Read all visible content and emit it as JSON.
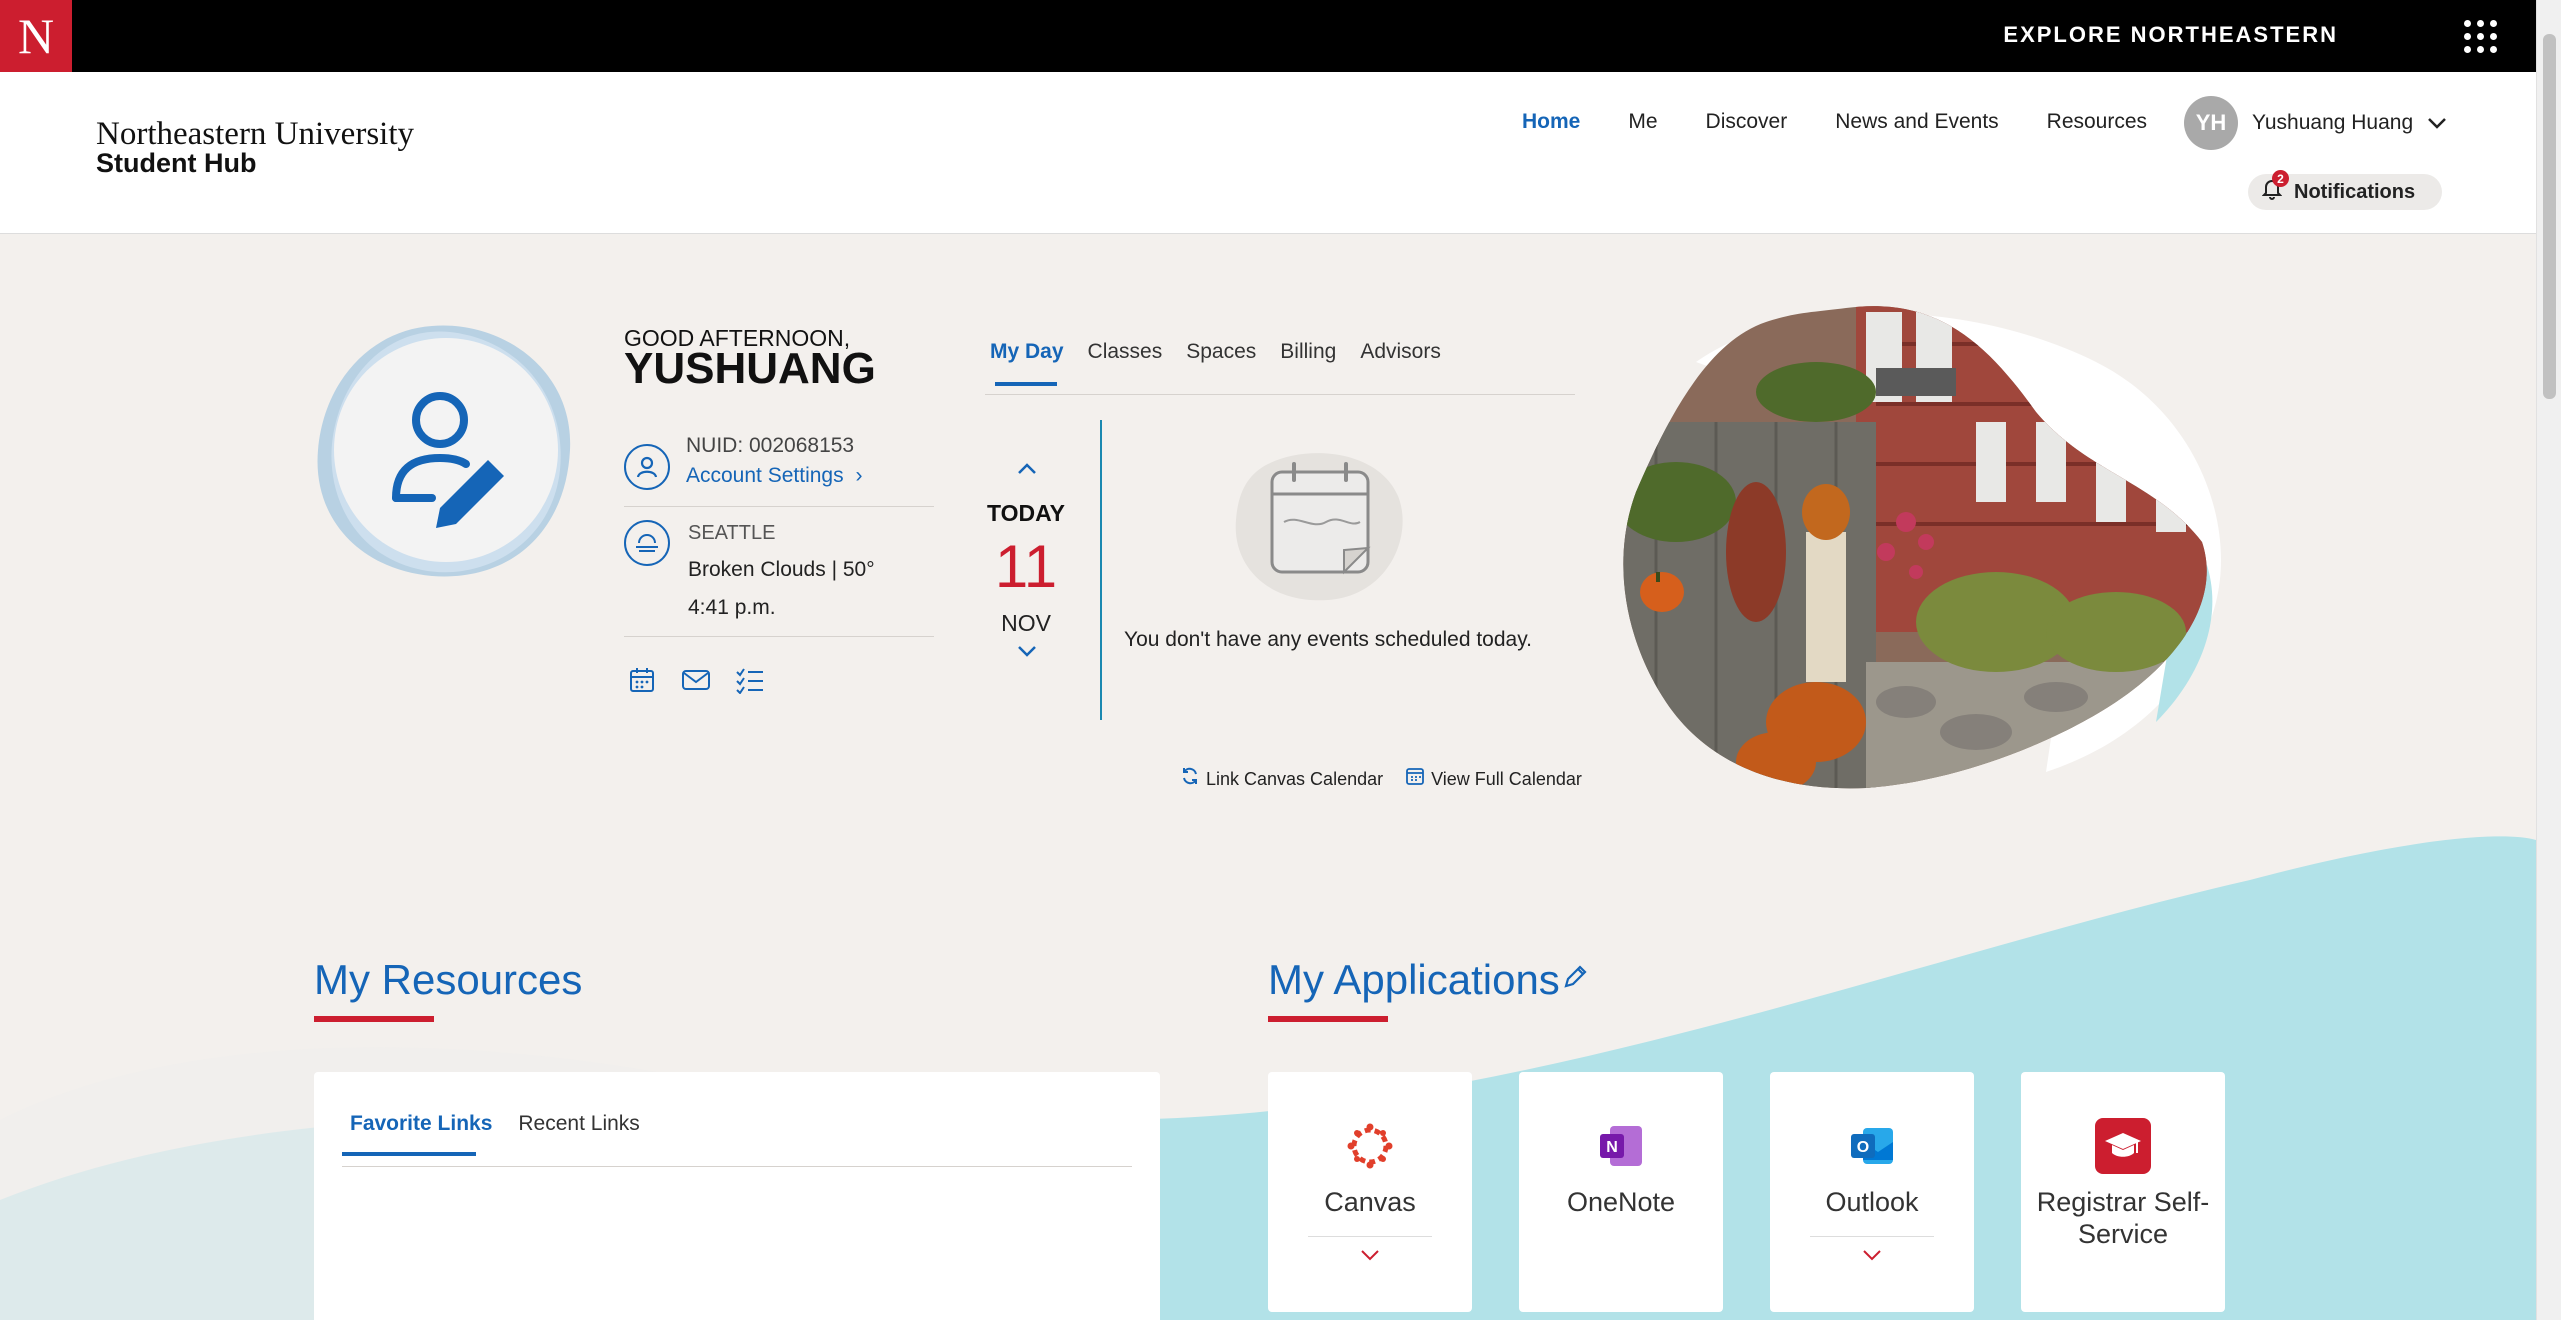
{
  "topbar": {
    "logo": "N",
    "explore_label": "EXPLORE NORTHEASTERN"
  },
  "brand": {
    "line1": "Northeastern University",
    "line2": "Student Hub"
  },
  "nav": {
    "items": [
      {
        "label": "Home",
        "active": true
      },
      {
        "label": "Me"
      },
      {
        "label": "Discover"
      },
      {
        "label": "News and Events"
      },
      {
        "label": "Resources"
      }
    ]
  },
  "user": {
    "initials": "YH",
    "name": "Yushuang Huang"
  },
  "notifications": {
    "label": "Notifications",
    "count": "2"
  },
  "profile": {
    "greeting": "GOOD AFTERNOON,",
    "name": "YUSHUANG",
    "nuid": "NUID: 002068153",
    "account_settings": "Account Settings",
    "city": "SEATTLE",
    "weather": "Broken Clouds | 50°",
    "time": "4:41 p.m."
  },
  "day_tabs": [
    "My Day",
    "Classes",
    "Spaces",
    "Billing",
    "Advisors"
  ],
  "calendar": {
    "today_label": "TODAY",
    "day": "11",
    "month": "NOV",
    "empty_message": "You don't have any events scheduled today.",
    "link_canvas": "Link Canvas Calendar",
    "view_full": "View Full Calendar"
  },
  "resources": {
    "title": "My Resources",
    "tabs": [
      "Favorite Links",
      "Recent Links"
    ]
  },
  "applications": {
    "title": "My Applications",
    "apps": [
      {
        "name": "Canvas",
        "color": "#e13f2b"
      },
      {
        "name": "OneNote",
        "color": "#7719aa"
      },
      {
        "name": "Outlook",
        "color": "#0f6cbd"
      },
      {
        "name": "Registrar Self-Service",
        "color": "#cc1e2f"
      }
    ]
  },
  "colors": {
    "accent": "#1565b7",
    "brand_red": "#cc1e2f",
    "teal": "#b2e2e8"
  }
}
